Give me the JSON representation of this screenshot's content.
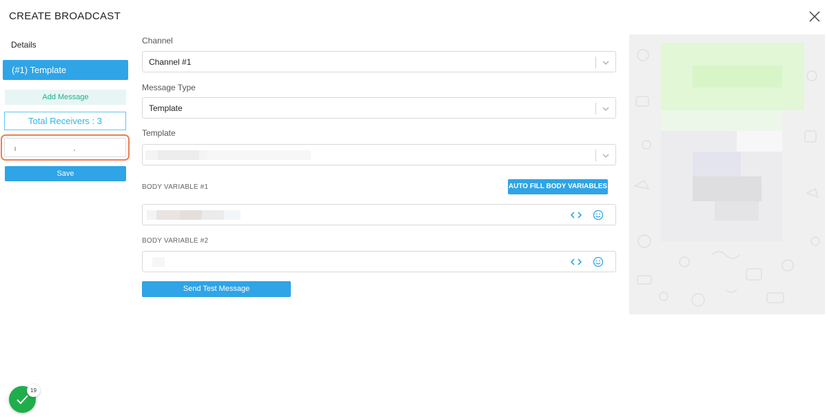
{
  "dialog": {
    "title": "CREATE BROADCAST"
  },
  "sidebar": {
    "details_label": "Details",
    "template_item": "(#1) Template",
    "add_message": "Add Message",
    "total_receivers": "Total Receivers : 3",
    "save": "Save"
  },
  "form": {
    "channel_label": "Channel",
    "channel_value": "Channel #1",
    "message_type_label": "Message Type",
    "message_type_value": "Template",
    "template_label": "Template",
    "body_variable_1_label": "BODY VARIABLE #1",
    "body_variable_2_label": "BODY VARIABLE #2",
    "auto_fill": "AUTO FILL BODY VARIABLES",
    "send_test": "Send Test Message"
  },
  "notification": {
    "count": "19"
  },
  "colors": {
    "primary": "#2fa4e7",
    "success": "#1fae4b",
    "highlight": "#ef7d52",
    "teal": "#1fae8e"
  },
  "icons": [
    "close-icon",
    "chevron-down-icon",
    "code-icon",
    "smile-icon",
    "check-icon"
  ]
}
